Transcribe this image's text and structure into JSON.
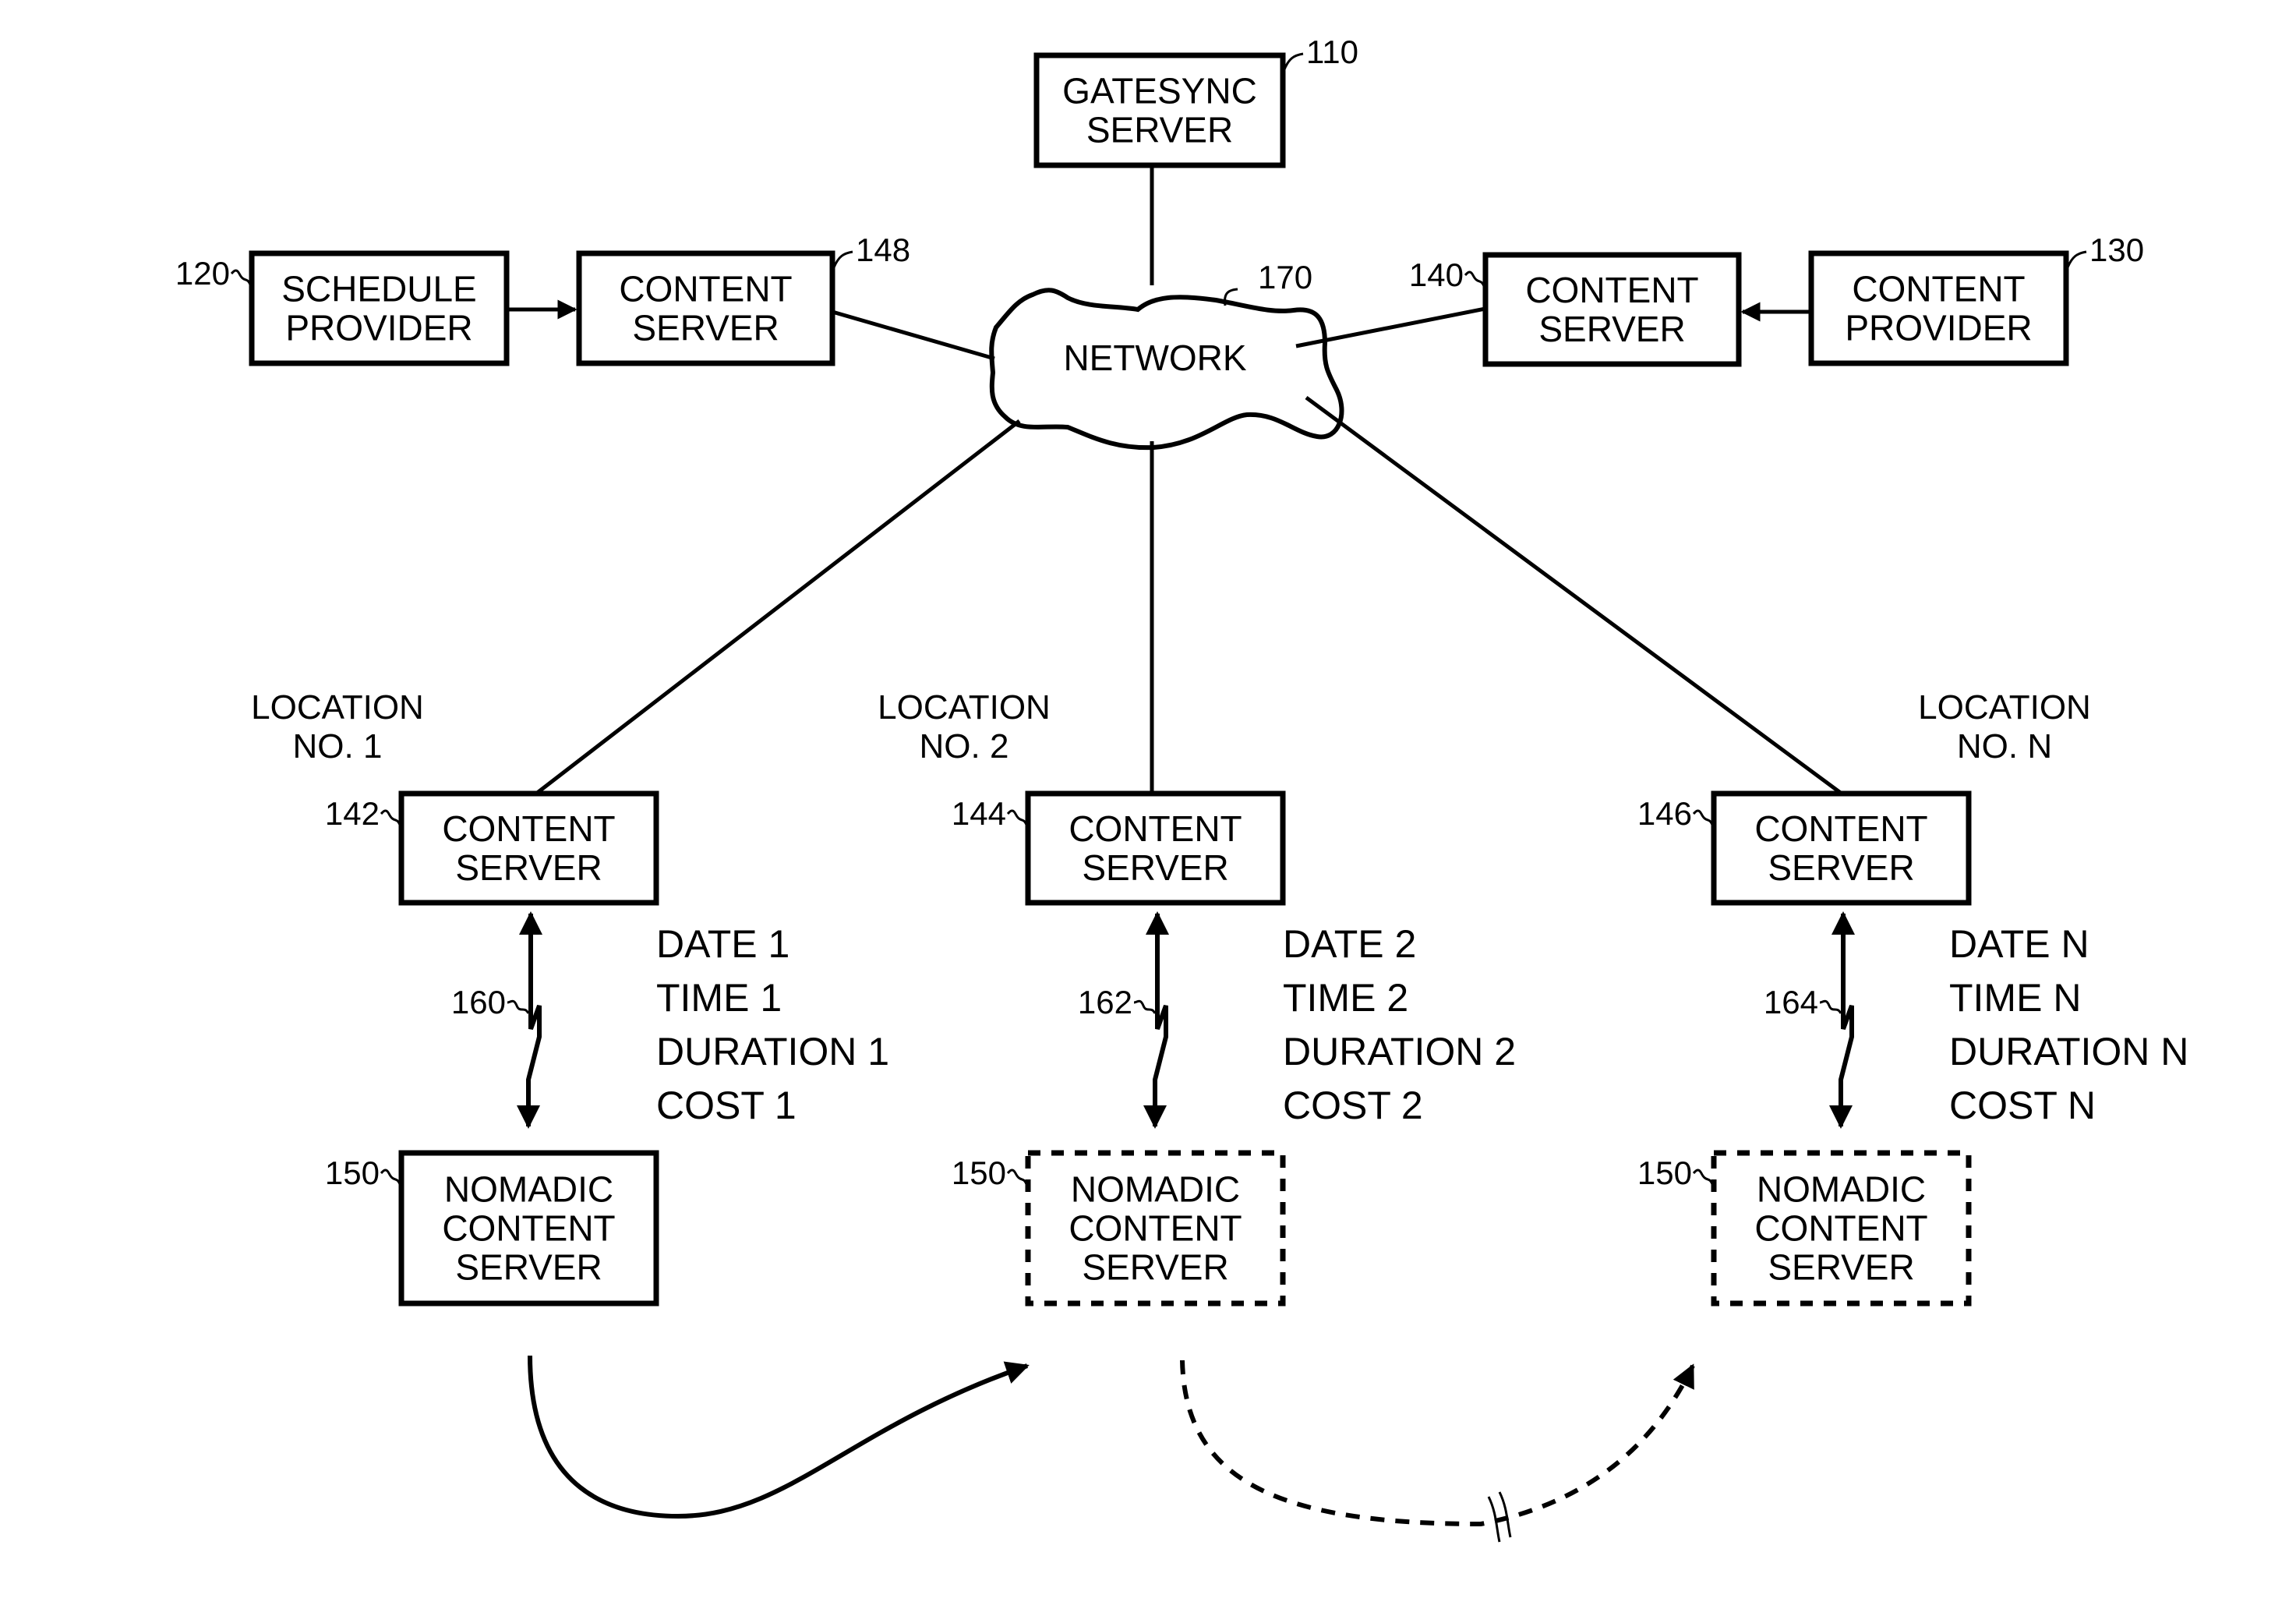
{
  "diagram": {
    "gatesync": {
      "ref": "110",
      "lines": [
        "GATESYNC",
        "SERVER"
      ]
    },
    "schedule_provider": {
      "ref": "120",
      "lines": [
        "SCHEDULE",
        "PROVIDER"
      ]
    },
    "content_server_148": {
      "ref": "148",
      "lines": [
        "CONTENT",
        "SERVER"
      ]
    },
    "network": {
      "ref": "170",
      "label": "NETWORK"
    },
    "content_server_140": {
      "ref": "140",
      "lines": [
        "CONTENT",
        "SERVER"
      ]
    },
    "content_provider": {
      "ref": "130",
      "lines": [
        "CONTENT",
        "PROVIDER"
      ]
    },
    "locations": [
      {
        "title": [
          "LOCATION",
          "NO. 1"
        ],
        "server": {
          "ref": "142",
          "lines": [
            "CONTENT",
            "SERVER"
          ]
        },
        "link_ref": "160",
        "info": [
          "DATE 1",
          "TIME 1",
          "DURATION 1",
          "COST 1"
        ],
        "nomadic": {
          "ref": "150",
          "lines": [
            "NOMADIC",
            "CONTENT",
            "SERVER"
          ],
          "style": "solid"
        }
      },
      {
        "title": [
          "LOCATION",
          "NO. 2"
        ],
        "server": {
          "ref": "144",
          "lines": [
            "CONTENT",
            "SERVER"
          ]
        },
        "link_ref": "162",
        "info": [
          "DATE 2",
          "TIME 2",
          "DURATION 2",
          "COST 2"
        ],
        "nomadic": {
          "ref": "150",
          "lines": [
            "NOMADIC",
            "CONTENT",
            "SERVER"
          ],
          "style": "dashed"
        }
      },
      {
        "title": [
          "LOCATION",
          "NO. N"
        ],
        "server": {
          "ref": "146",
          "lines": [
            "CONTENT",
            "SERVER"
          ]
        },
        "link_ref": "164",
        "info": [
          "DATE N",
          "TIME N",
          "DURATION N",
          "COST N"
        ],
        "nomadic": {
          "ref": "150",
          "lines": [
            "NOMADIC",
            "CONTENT",
            "SERVER"
          ],
          "style": "dashed"
        }
      }
    ]
  }
}
